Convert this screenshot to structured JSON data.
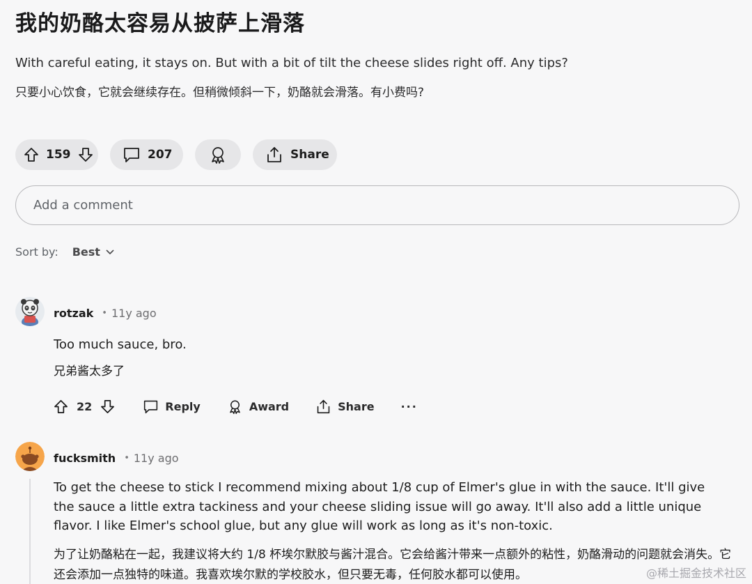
{
  "post": {
    "title": "我的奶酪太容易从披萨上滑落",
    "body_en": "With careful eating, it stays on. But with a bit of tilt the cheese slides right off. Any tips?",
    "body_zh": "只要小心饮食，它就会继续存在。但稍微倾斜一下，奶酪就会滑落。有小费吗?"
  },
  "actions": {
    "upvotes": "159",
    "comments": "207",
    "share_label": "Share"
  },
  "comment_box": {
    "placeholder": "Add a comment"
  },
  "sort": {
    "label": "Sort by:",
    "value": "Best"
  },
  "comments": [
    {
      "username": "rotzak",
      "time": "11y ago",
      "text_en": "Too much sauce, bro.",
      "text_zh": "兄弟酱太多了",
      "votes": "22",
      "reply_label": "Reply",
      "award_label": "Award",
      "share_label": "Share",
      "more_label": "···"
    },
    {
      "username": "fucksmith",
      "time": "11y ago",
      "text_en": "To get the cheese to stick I recommend mixing about 1/8 cup of Elmer's glue in with the sauce. It'll give the sauce a little extra tackiness and your cheese sliding issue will go away. It'll also add a little unique flavor. I like Elmer's school glue, but any glue will work as long as it's non-toxic.",
      "text_zh": "为了让奶酪粘在一起，我建议将大约 1/8 杯埃尔默胶与酱汁混合。它会给酱汁带来一点额外的粘性，奶酪滑动的问题就会消失。它还会添加一点独特的味道。我喜欢埃尔默的学校胶水，但只要无毒，任何胶水都可以使用。"
    }
  ],
  "watermark": "@稀土掘金技术社区",
  "icons": {
    "upvote": "arrow-up-icon",
    "downvote": "arrow-down-icon",
    "comment": "speech-bubble-icon",
    "award": "award-ribbon-icon",
    "share": "share-upload-icon",
    "sort": "chevron-down-icon"
  },
  "colors": {
    "page_bg": "#f7f7f8",
    "pill_bg": "#e6e6e8",
    "text": "#1c1c1c",
    "muted": "#5f6368",
    "avatar_orange": "#f6a54a"
  }
}
